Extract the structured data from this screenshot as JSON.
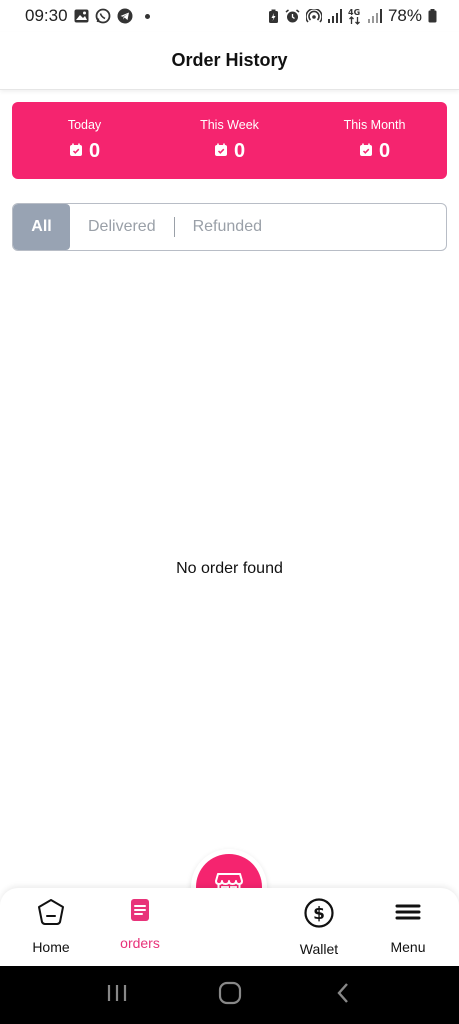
{
  "status_bar": {
    "time": "09:30",
    "battery_percent": "78%",
    "network_label": "4G"
  },
  "header": {
    "title": "Order History"
  },
  "stats": [
    {
      "label": "Today",
      "value": "0"
    },
    {
      "label": "This Week",
      "value": "0"
    },
    {
      "label": "This Month",
      "value": "0"
    }
  ],
  "filters": {
    "tabs": [
      {
        "label": "All",
        "selected": true
      },
      {
        "label": "Delivered",
        "selected": false
      },
      {
        "label": "Refunded",
        "selected": false
      }
    ]
  },
  "empty_state": {
    "message": "No order found"
  },
  "bottom_nav": {
    "items": [
      {
        "label": "Home",
        "icon": "home-icon",
        "active": false
      },
      {
        "label": "orders",
        "icon": "orders-icon",
        "active": true
      },
      {
        "label": "Wallet",
        "icon": "wallet-dollar-icon",
        "active": false
      },
      {
        "label": "Menu",
        "icon": "menu-icon",
        "active": false
      }
    ],
    "center_button_icon": "store-icon"
  },
  "colors": {
    "accent": "#f5246f",
    "tab_selected_bg": "#98a3b3",
    "tab_text": "#9aa0a8",
    "active_nav": "#e8337a"
  }
}
